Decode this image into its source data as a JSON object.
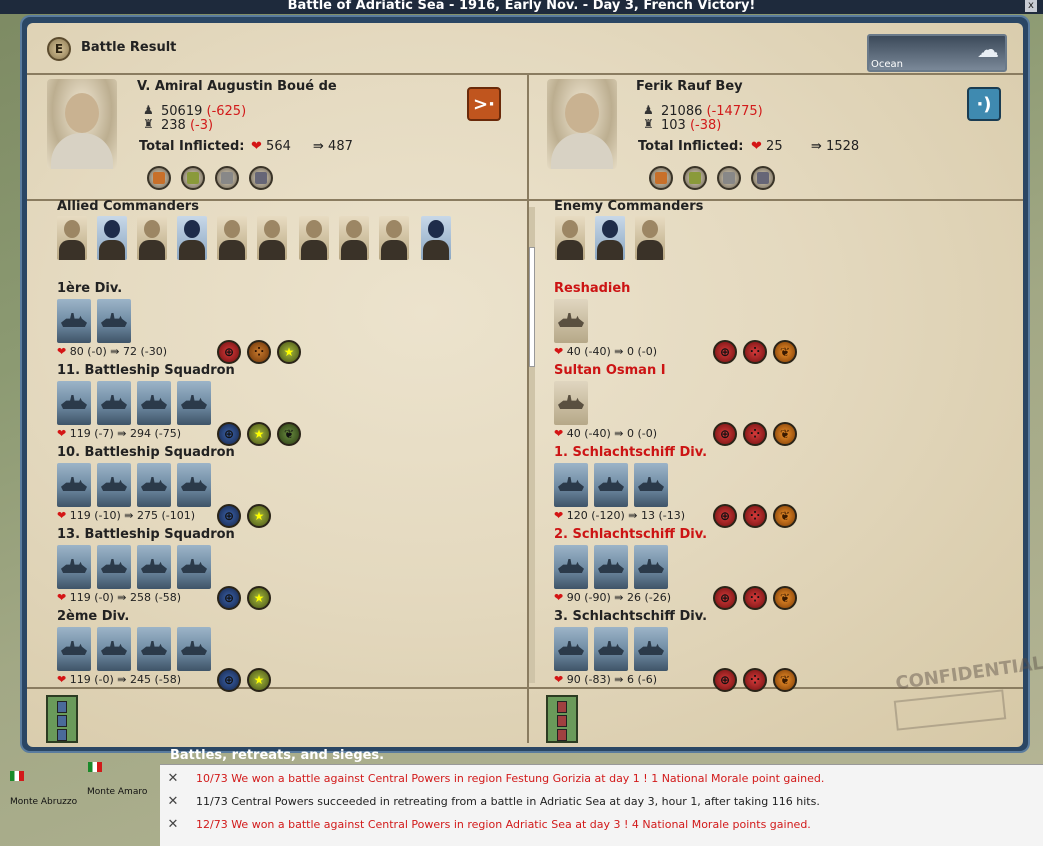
{
  "window_title": "Battle of Adriatic Sea - 1916, Early Nov. - Day 3, French Victory!",
  "close_glyph": "x",
  "header": {
    "e_button": "E",
    "title": "Battle Result",
    "weather_label": "Ocean",
    "weather_icon": "rain-cloud-icon"
  },
  "allied": {
    "commander_name": "V. Amiral Augustin Boué de",
    "men": "50619",
    "men_loss": "(-625)",
    "ships": "238",
    "ships_loss": "(-3)",
    "total_label": "Total Inflicted:",
    "hits": "564",
    "attacks": "487",
    "commanders_label": "Allied Commanders",
    "units": [
      {
        "name": "1ère Div.",
        "hp": "80 (-0)",
        "dmg": "72 (-30)"
      },
      {
        "name": "11. Battleship Squadron",
        "hp": "119 (-7)",
        "dmg": "294 (-75)"
      },
      {
        "name": "10. Battleship Squadron",
        "hp": "119 (-10)",
        "dmg": "275 (-101)"
      },
      {
        "name": "13. Battleship Squadron",
        "hp": "119 (-0)",
        "dmg": "258 (-58)"
      },
      {
        "name": "2ème Div.",
        "hp": "119 (-0)",
        "dmg": "245 (-58)"
      }
    ]
  },
  "enemy": {
    "commander_name": "Ferik Rauf Bey",
    "men": "21086",
    "men_loss": "(-14775)",
    "ships": "103",
    "ships_loss": "(-38)",
    "total_label": "Total Inflicted:",
    "hits": "25",
    "attacks": "1528",
    "commanders_label": "Enemy Commanders",
    "units": [
      {
        "name": "Reshadieh",
        "hp": "40 (-40)",
        "dmg": "0 (-0)"
      },
      {
        "name": "Sultan Osman I",
        "hp": "40 (-40)",
        "dmg": "0 (-0)"
      },
      {
        "name": "1. Schlachtschiff Div.",
        "hp": "120 (-120)",
        "dmg": "13 (-13)"
      },
      {
        "name": "2. Schlachtschiff Div.",
        "hp": "90 (-90)",
        "dmg": "26 (-26)"
      },
      {
        "name": "3. Schlachtschiff Div.",
        "hp": "90 (-83)",
        "dmg": "6 (-6)"
      }
    ]
  },
  "stamp": "CONFIDENTIAL",
  "news": {
    "heading": "Battles, retreats, and sieges.",
    "rows": [
      {
        "text": "10/73 We won a battle against Central Powers in region Festung Gorizia at day 1 ! 1 National Morale point gained.",
        "color": "#d21a1a"
      },
      {
        "text": "11/73 Central Powers succeeded in retreating from a battle in Adriatic Sea at day 3, hour 1, after taking 116 hits.",
        "color": "#222222"
      },
      {
        "text": "12/73 We won a battle against Central Powers in region Adriatic Sea at day 3 ! 4 National Morale points gained.",
        "color": "#d21a1a"
      }
    ]
  },
  "map": {
    "towns": [
      "Monte Abruzzo",
      "Monte Amaro"
    ]
  }
}
